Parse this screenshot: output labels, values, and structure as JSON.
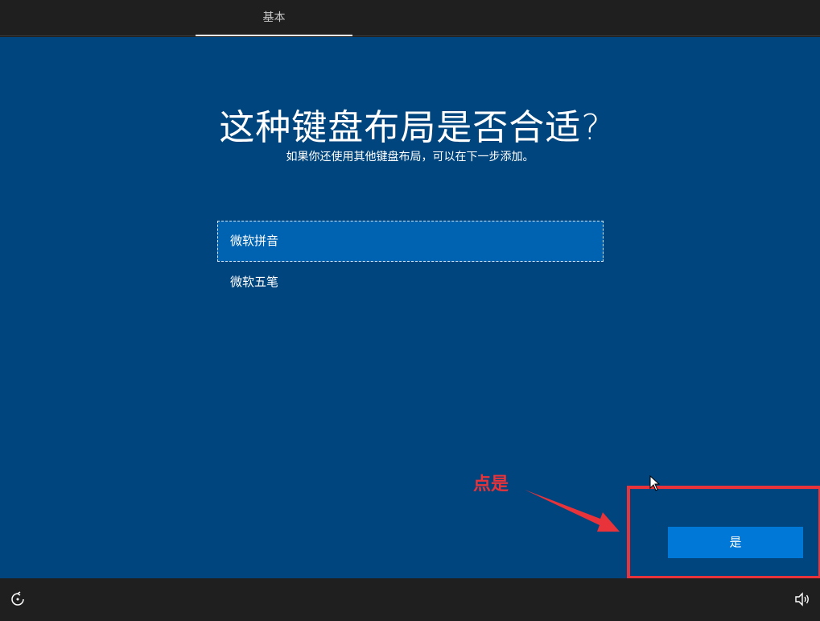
{
  "header": {
    "tab_label": "基本"
  },
  "main": {
    "title": "这种键盘布局是否合适?",
    "subtitle": "如果你还使用其他键盘布局，可以在下一步添加。",
    "options": [
      {
        "label": "微软拼音",
        "selected": true
      },
      {
        "label": "微软五笔",
        "selected": false
      }
    ]
  },
  "annotation": {
    "text": "点是",
    "color": "#e8333a"
  },
  "footer": {
    "yes_label": "是",
    "icons": [
      "accessibility-icon",
      "volume-icon"
    ]
  },
  "colors": {
    "background": "#00457d",
    "selected": "#0063b1",
    "button": "#0078d7"
  }
}
